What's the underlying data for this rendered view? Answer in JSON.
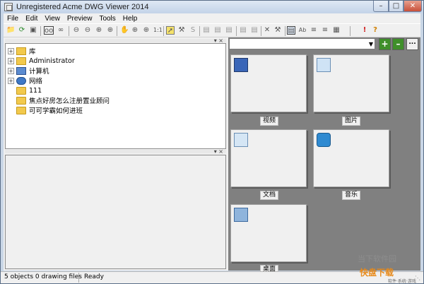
{
  "window": {
    "title": "Unregistered Acme DWG Viewer 2014"
  },
  "menu": [
    "File",
    "Edit",
    "View",
    "Preview",
    "Tools",
    "Help"
  ],
  "toolbar": {
    "icons": [
      "folder-open-icon",
      "refresh-icon",
      "save-icon",
      "view-mode-icon",
      "link-icon",
      "zoom-out-icon",
      "zoom-out-small-icon",
      "zoom-in-icon",
      "zoom-extent-icon",
      "pan-icon",
      "zoom-window-icon",
      "zoom-in-alt-icon",
      "zoom-1to1-icon",
      "measure-icon",
      "wrench-icon",
      "layers-icon",
      "properties-icon",
      "copy-icon",
      "paste-icon",
      "clipboard-icon",
      "delete-icon",
      "hammer-icon",
      "print-preview-icon",
      "text-size-icon",
      "list-icon",
      "tree-icon",
      "columns-icon",
      "exclamation-icon",
      "help-icon"
    ]
  },
  "tree": {
    "items": [
      {
        "label": "库",
        "expandable": true,
        "icon": "library-icon"
      },
      {
        "label": "Administrator",
        "expandable": true,
        "icon": "user-folder-icon"
      },
      {
        "label": "计算机",
        "expandable": true,
        "icon": "computer-icon"
      },
      {
        "label": "网络",
        "expandable": true,
        "icon": "network-icon"
      },
      {
        "label": "111",
        "expandable": false,
        "icon": "folder-icon"
      },
      {
        "label": "焦点好房怎么注册置业顾问",
        "expandable": false,
        "icon": "folder-icon"
      },
      {
        "label": "可可学霸如何进班",
        "expandable": false,
        "icon": "folder-icon"
      }
    ]
  },
  "thumbnails": {
    "items": [
      {
        "label": "视频",
        "icon": "video-library-icon"
      },
      {
        "label": "图片",
        "icon": "picture-library-icon"
      },
      {
        "label": "文档",
        "icon": "document-library-icon"
      },
      {
        "label": "音乐",
        "icon": "music-library-icon"
      },
      {
        "label": "桌面",
        "icon": "desktop-icon"
      }
    ]
  },
  "status": {
    "count": "5 objects 0 drawing files",
    "state": "Ready"
  },
  "watermark": {
    "faint": "当下软件园",
    "brand": "快盘下载",
    "site": "软件·系统·游戏"
  },
  "colors": {
    "thumb_bg": "#808080",
    "folder": "#f2c94c",
    "add_button": "#3f8f2a"
  }
}
